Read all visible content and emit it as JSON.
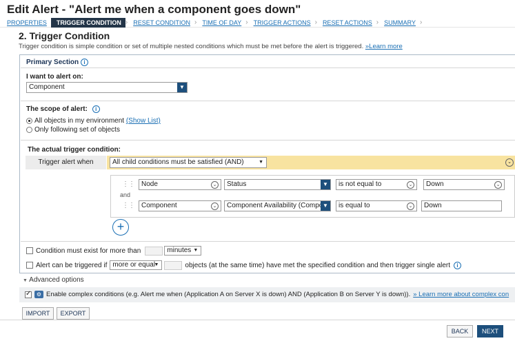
{
  "title": "Edit Alert - \"Alert me when a component goes down\"",
  "wizard": {
    "steps": [
      "PROPERTIES",
      "TRIGGER CONDITION",
      "RESET CONDITION",
      "TIME OF DAY",
      "TRIGGER ACTIONS",
      "RESET ACTIONS",
      "SUMMARY"
    ],
    "active": "TRIGGER CONDITION"
  },
  "heading": "2. Trigger Condition",
  "description": "Trigger condition is simple condition or set of multiple nested conditions which must be met before the alert is triggered.",
  "learn_more": "»Learn more",
  "primary_section": {
    "title": "Primary Section",
    "alert_on_label": "I want to alert on:",
    "alert_on_value": "Component",
    "scope_label": "The scope of alert:",
    "scope_all": "All objects in my environment",
    "show_list": "(Show List)",
    "scope_following": "Only following set of objects",
    "scope_selected": "all",
    "actual_label": "The actual trigger condition:",
    "trigger_when_label": "Trigger alert when",
    "trigger_when_value": "All child conditions must be satisfied (AND)",
    "conditions": [
      {
        "object": "Node",
        "field": "Status",
        "operator": "is not equal to",
        "value": "Down"
      },
      {
        "object": "Component",
        "field": "Component Availability (Compon",
        "operator": "is equal to",
        "value": "Down"
      }
    ],
    "and_label": "and",
    "must_exist_label": "Condition must exist for more than",
    "must_exist_unit": "minutes",
    "can_trigger_prefix": "Alert can be triggered if",
    "can_trigger_select": "more or equal",
    "can_trigger_suffix": "objects (at the same time) have met the specified condition and then trigger single alert"
  },
  "advanced": {
    "label": "Advanced options",
    "complex_text": "Enable complex conditions (e.g. Alert me when (Application A on Server X is down) AND (Application B on Server Y is down)).",
    "complex_link": "» Learn more about complex con",
    "complex_checked": true
  },
  "buttons": {
    "import": "IMPORT",
    "export": "EXPORT",
    "back": "BACK",
    "next": "NEXT"
  },
  "colors": {
    "accent": "#1d4f7c",
    "link": "#1a6fb4",
    "active_step": "#233548",
    "trigger_bar": "#f8e3a0"
  }
}
